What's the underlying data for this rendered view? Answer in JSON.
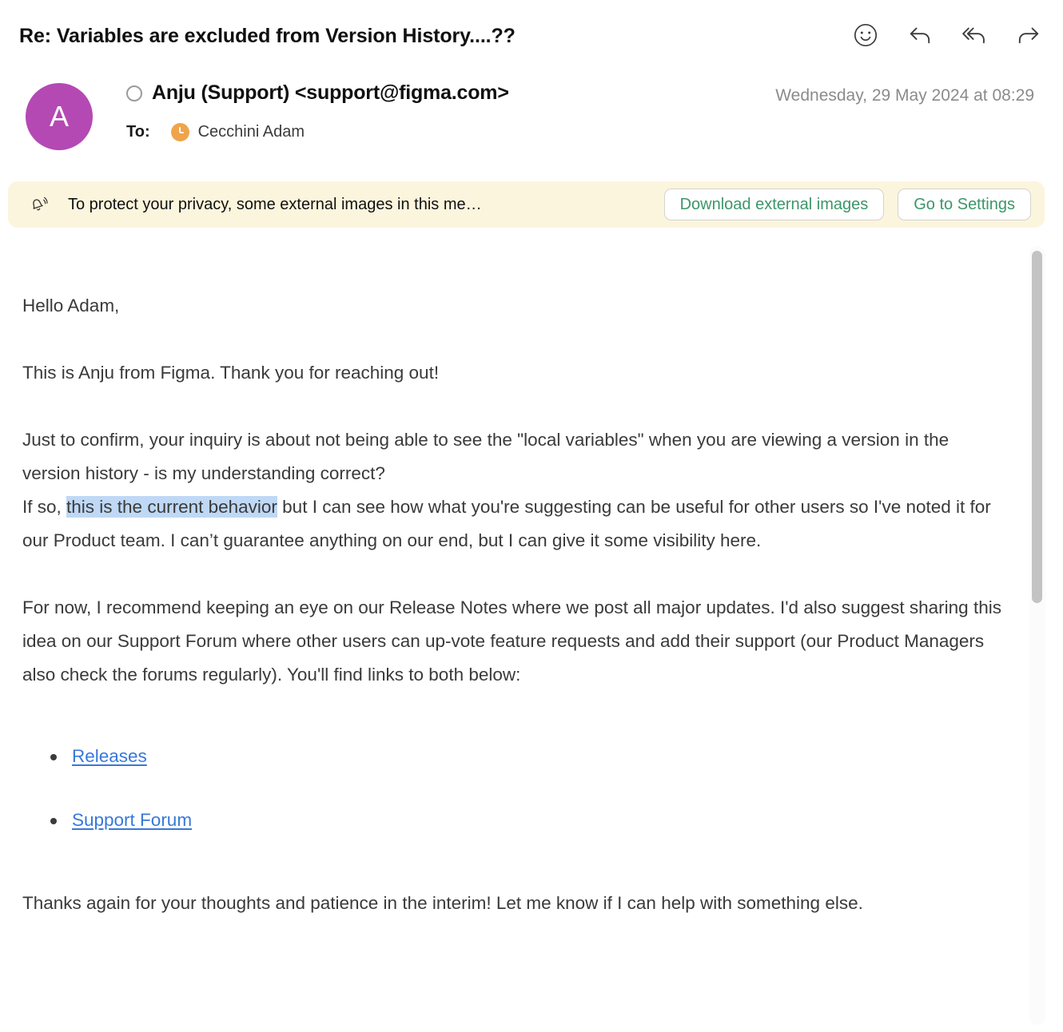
{
  "header": {
    "subject": "Re: Variables are excluded from Version History....??",
    "actions": [
      {
        "name": "emoji-reaction",
        "label": "Add reaction"
      },
      {
        "name": "reply",
        "label": "Reply"
      },
      {
        "name": "reply-all",
        "label": "Reply All"
      },
      {
        "name": "forward",
        "label": "Forward"
      }
    ]
  },
  "message": {
    "avatar_initial": "A",
    "avatar_color": "#b449b4",
    "sender": "Anju (Support) <support@figma.com>",
    "to_label": "To:",
    "to_recipient": "Cecchini Adam",
    "date": "Wednesday, 29 May 2024 at 08:29"
  },
  "banner": {
    "text": "To protect your privacy, some external images in this me…",
    "download_button": "Download external images",
    "settings_button": "Go to Settings",
    "background_color": "#fcf5dd",
    "button_text_color": "#3c9668"
  },
  "body": {
    "greeting": "Hello Adam,",
    "paragraph_1": "This is Anju from Figma. Thank you for reaching out!",
    "paragraph_2_line_1": "Just to confirm, your inquiry is about not being able to see the \"local variables\" when you are viewing a version in the version history - is my understanding correct?",
    "paragraph_2_line_2_prefix": "If so, ",
    "paragraph_2_highlight": "this is the current behavior",
    "paragraph_2_line_2_suffix": " but I can see how what you're suggesting can be useful for other users so I've noted it for our Product team. I can’t guarantee anything on our end, but I can give it some visibility here.",
    "highlight_color": "#bfd8f5",
    "paragraph_3": "For now, I recommend keeping an eye on our Release Notes where we post all major updates. I'd also suggest sharing this idea on our Support Forum where other users can up-vote feature requests and add their support (our Product Managers also check the forums regularly). You'll find links to both below:",
    "links": [
      {
        "label": "Releases"
      },
      {
        "label": "Support Forum"
      }
    ],
    "link_color": "#3878d8",
    "paragraph_4": "Thanks again for your thoughts and patience in the interim! Let me know if I can help with something else."
  }
}
